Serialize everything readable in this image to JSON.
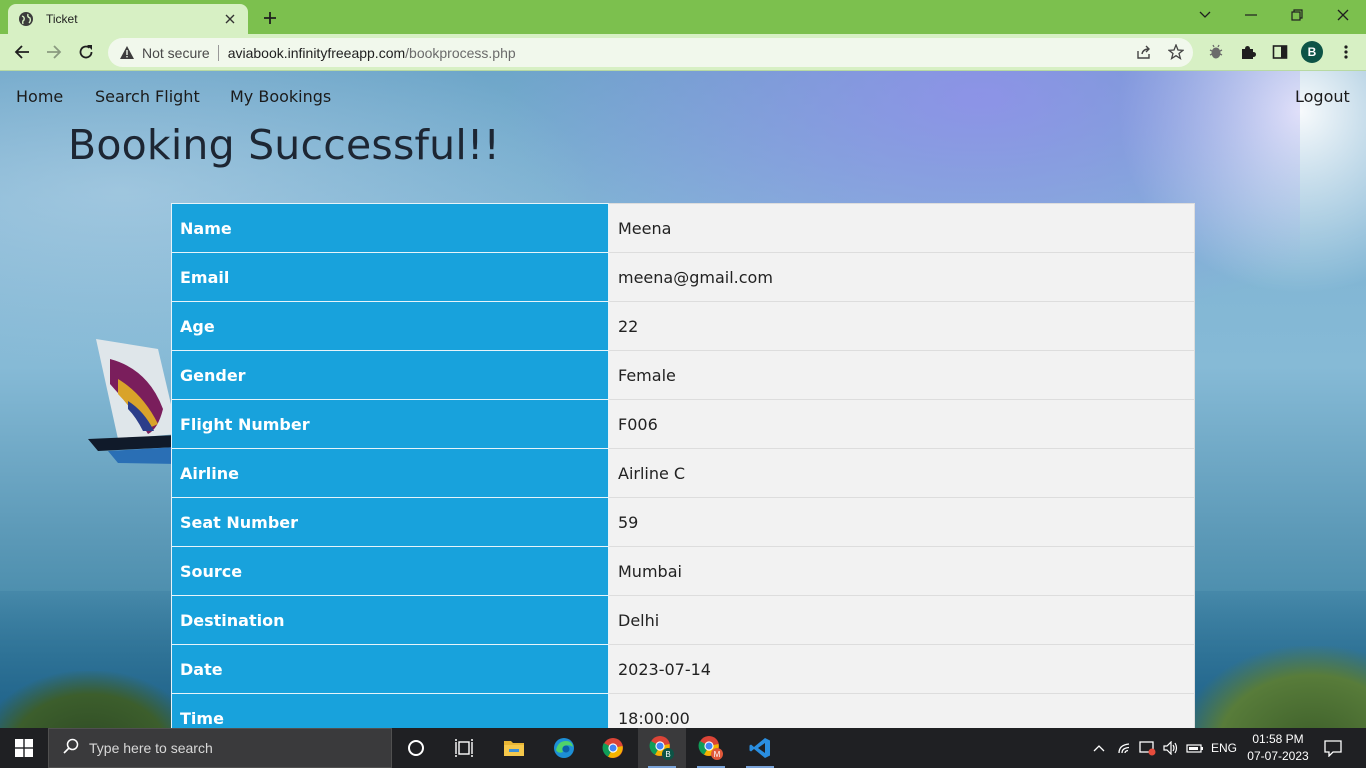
{
  "browser": {
    "tab_title": "Ticket",
    "address": {
      "security_label": "Not secure",
      "host": "aviabook.infinityfreeapp.com",
      "path": "/bookprocess.php"
    },
    "profile_initial": "B"
  },
  "nav": {
    "items": [
      "Home",
      "Search Flight",
      "My Bookings"
    ],
    "logout": "Logout"
  },
  "page": {
    "heading": "Booking Successful!!"
  },
  "ticket": [
    {
      "label": "Name",
      "value": "Meena"
    },
    {
      "label": "Email",
      "value": "meena@gmail.com"
    },
    {
      "label": "Age",
      "value": "22"
    },
    {
      "label": "Gender",
      "value": "Female"
    },
    {
      "label": "Flight Number",
      "value": "F006"
    },
    {
      "label": "Airline",
      "value": "Airline C"
    },
    {
      "label": "Seat Number",
      "value": "59"
    },
    {
      "label": "Source",
      "value": "Mumbai"
    },
    {
      "label": "Destination",
      "value": "Delhi"
    },
    {
      "label": "Date",
      "value": "2023-07-14"
    },
    {
      "label": "Time",
      "value": "18:00:00"
    }
  ],
  "taskbar": {
    "search_placeholder": "Type here to search",
    "language": "ENG",
    "time": "01:58 PM",
    "date": "07-07-2023"
  },
  "colors": {
    "chrome_green": "#7cc04e",
    "toolbar_green": "#d7f0c4",
    "label_cell": "#18a2dc",
    "value_cell": "#f2f2f2"
  }
}
